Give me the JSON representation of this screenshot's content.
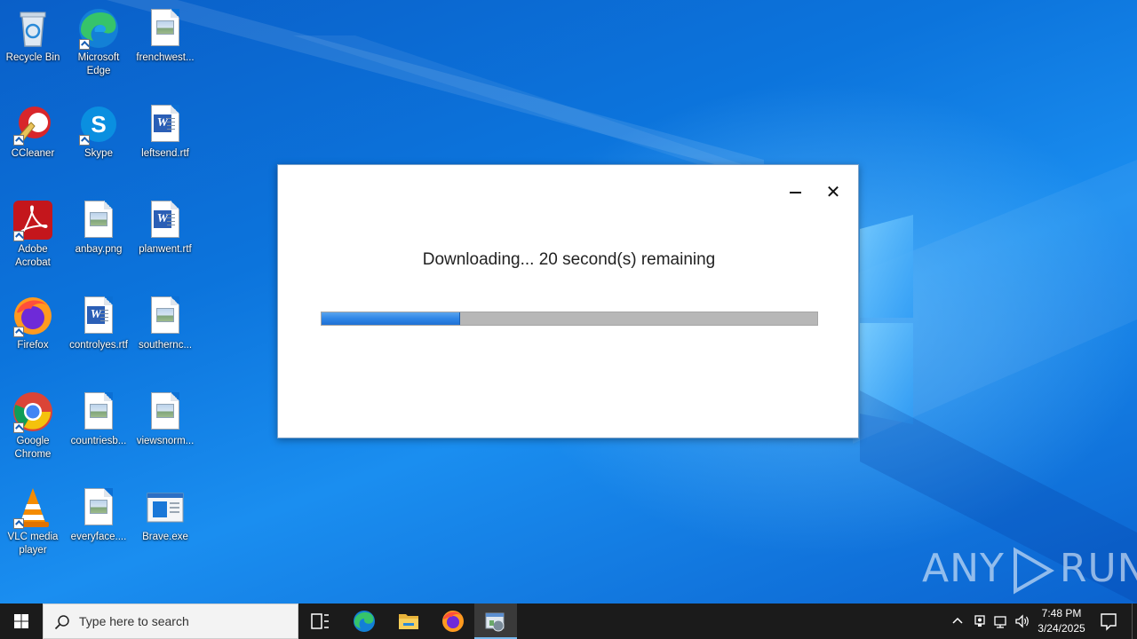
{
  "desktop": {
    "icons": [
      {
        "label": "Recycle Bin",
        "icon": "recycle-bin-icon"
      },
      {
        "label": "Microsoft Edge",
        "icon": "edge-icon"
      },
      {
        "label": "frenchwest...",
        "icon": "image-file-icon"
      },
      {
        "label": "CCleaner",
        "icon": "ccleaner-icon"
      },
      {
        "label": "Skype",
        "icon": "skype-icon"
      },
      {
        "label": "leftsend.rtf",
        "icon": "word-doc-icon"
      },
      {
        "label": "Adobe Acrobat",
        "icon": "acrobat-icon"
      },
      {
        "label": "anbay.png",
        "icon": "image-file-icon"
      },
      {
        "label": "planwent.rtf",
        "icon": "word-doc-icon"
      },
      {
        "label": "Firefox",
        "icon": "firefox-icon"
      },
      {
        "label": "controlyes.rtf",
        "icon": "word-doc-icon"
      },
      {
        "label": "southernc...",
        "icon": "image-file-icon"
      },
      {
        "label": "Google Chrome",
        "icon": "chrome-icon"
      },
      {
        "label": "countriesb...",
        "icon": "image-file-icon"
      },
      {
        "label": "viewsnorm...",
        "icon": "image-file-icon"
      },
      {
        "label": "VLC media player",
        "icon": "vlc-icon"
      },
      {
        "label": "everyface....",
        "icon": "image-file-icon"
      },
      {
        "label": "Brave.exe",
        "icon": "exe-file-icon"
      }
    ]
  },
  "dialog": {
    "message": "Downloading... 20 second(s) remaining",
    "progress_percent": 28,
    "close_glyph": "✕",
    "accent_color": "#2f86e6"
  },
  "watermark": {
    "left": "ANY",
    "right": "RUN"
  },
  "taskbar": {
    "search_placeholder": "Type here to search",
    "pinned": [
      "task-view-icon",
      "edge-icon",
      "file-explorer-icon",
      "firefox-icon",
      "installer-icon"
    ],
    "clock_time": "7:48 PM",
    "clock_date": "3/24/2025"
  }
}
